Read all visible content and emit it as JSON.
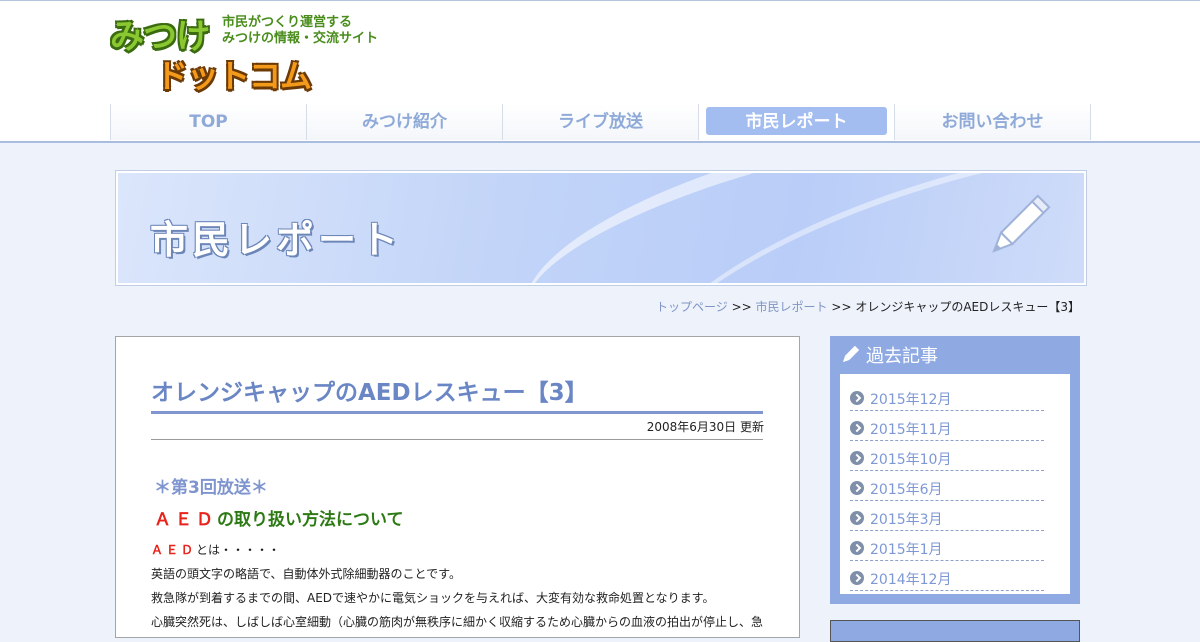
{
  "logo": {
    "word_top": "みつけ",
    "word_bottom": "ドットコム",
    "tagline_1": "市民がつくり運営する",
    "tagline_2": "みつけの情報・交流サイト"
  },
  "nav": {
    "items": [
      {
        "label": "TOP"
      },
      {
        "label": "みつけ紹介"
      },
      {
        "label": "ライブ放送"
      },
      {
        "label": "市民レポート"
      },
      {
        "label": "お問い合わせ"
      }
    ]
  },
  "banner": {
    "title": "市民レポート",
    "icon": "pencil-icon"
  },
  "breadcrumb": {
    "home": "トップページ",
    "sep": ">>",
    "section": "市民レポート",
    "current": "オレンジキャップのAEDレスキュー【3】"
  },
  "article": {
    "title": "オレンジキャップのAEDレスキュー【3】",
    "date": "2008年6月30日 更新",
    "episode": "＊第3回放送＊",
    "subhead_red": "ＡＥＤ",
    "subhead_rest": "の取り扱い方法について",
    "line1_red": "ＡＥＤ",
    "line1_rest": "とは・・・・・",
    "line2": "英語の頭文字の略語で、自動体外式除細動器のことです。",
    "line3": "救急隊が到着するまでの間、AEDで速やかに電気ショックを与えれば、大変有効な救命処置となります。",
    "line4": "心臓突然死は、しばしば心室細動（心臓の筋肉が無秩序に細かく収縮するため心臓からの血液の拍出が停止し、急"
  },
  "sidebar": {
    "title": "過去記事",
    "icon": "pencil-icon",
    "items": [
      {
        "label": "2015年12月"
      },
      {
        "label": "2015年11月"
      },
      {
        "label": "2015年10月"
      },
      {
        "label": "2015年6月"
      },
      {
        "label": "2015年3月"
      },
      {
        "label": "2015年1月"
      },
      {
        "label": "2014年12月"
      }
    ]
  },
  "colors": {
    "accent": "#8fa9e3",
    "title_blue": "#6b86c5",
    "nav_active": "#a3bdf1",
    "link": "#7f95c4",
    "subhead_green": "#2d7a14",
    "aed_red": "#e8231b"
  }
}
